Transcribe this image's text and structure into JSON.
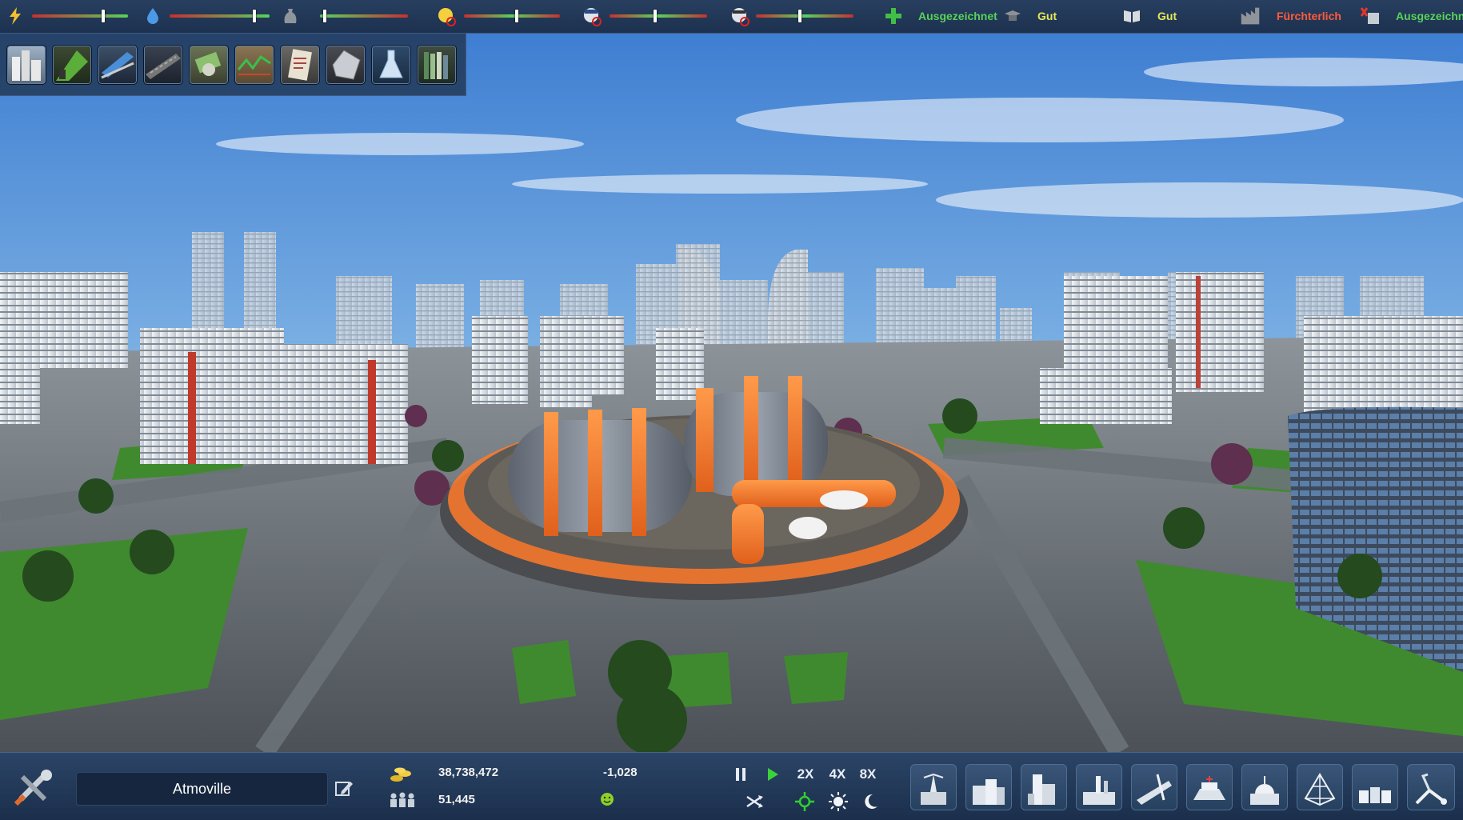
{
  "colors": {
    "accent_green": "#58d25a",
    "accent_red": "#ff5a3c",
    "sky_top": "#3b82d6",
    "sky_bottom": "#d4e3ef",
    "orange": "#ff7a2a"
  },
  "topbar": {
    "stats": [
      {
        "id": "power",
        "icon": "lightning-icon",
        "level": 0.75
      },
      {
        "id": "water",
        "icon": "water-drop-icon",
        "level": 0.86
      },
      {
        "id": "waste",
        "icon": "waste-bag-icon",
        "level": 0.04
      },
      {
        "id": "fire",
        "icon": "firefighter-icon",
        "level": 0.55
      },
      {
        "id": "police",
        "icon": "police-icon",
        "level": 0.47
      },
      {
        "id": "health",
        "icon": "doctor-icon",
        "level": 0.45
      }
    ],
    "ratings": [
      {
        "id": "health_rating",
        "icon": "medical-cross-icon",
        "label": "Ausgezeichnet",
        "color": "#58d25a"
      },
      {
        "id": "education_rating",
        "icon": "graduation-icon",
        "label": "Gut",
        "color": "#e4e858"
      },
      {
        "id": "culture_rating",
        "icon": "book-icon",
        "label": "Gut",
        "color": "#e4e858"
      },
      {
        "id": "pollution_rating",
        "icon": "factory-icon",
        "label": "Fürchterlich",
        "color": "#ff5a3c"
      },
      {
        "id": "recycling_rating",
        "icon": "recycling-icon",
        "label": "Ausgezeichnet",
        "color": "#58d25a"
      }
    ]
  },
  "categories": [
    {
      "name": "category-residential",
      "icon": "residential-icon"
    },
    {
      "name": "category-terrain",
      "icon": "terrain-icon"
    },
    {
      "name": "category-transport",
      "icon": "transport-icon"
    },
    {
      "name": "category-roads",
      "icon": "roads-icon"
    },
    {
      "name": "category-finance",
      "icon": "money-icon"
    },
    {
      "name": "category-statistics",
      "icon": "chart-icon"
    },
    {
      "name": "category-policies",
      "icon": "document-icon"
    },
    {
      "name": "category-resources",
      "icon": "crystal-icon"
    },
    {
      "name": "category-research",
      "icon": "flask-icon"
    },
    {
      "name": "category-library",
      "icon": "books-icon"
    }
  ],
  "bottombar": {
    "city_name": "Atmoville",
    "money": "38,738,472",
    "population": "51,445",
    "income": "-1,028",
    "speed": {
      "x2": "2X",
      "x4": "4X",
      "x8": "8X"
    }
  },
  "build_buttons": [
    {
      "name": "build-power",
      "icon": "power-plant-icon"
    },
    {
      "name": "build-residential",
      "icon": "residential-building-icon"
    },
    {
      "name": "build-commercial",
      "icon": "commercial-building-icon"
    },
    {
      "name": "build-industry",
      "icon": "industry-icon"
    },
    {
      "name": "build-roads",
      "icon": "road-icon"
    },
    {
      "name": "build-services",
      "icon": "services-icon"
    },
    {
      "name": "build-government",
      "icon": "government-dome-icon"
    },
    {
      "name": "build-special",
      "icon": "dome-structure-icon"
    },
    {
      "name": "build-storage",
      "icon": "storage-icon"
    },
    {
      "name": "build-demolish",
      "icon": "demolish-crane-icon"
    }
  ]
}
